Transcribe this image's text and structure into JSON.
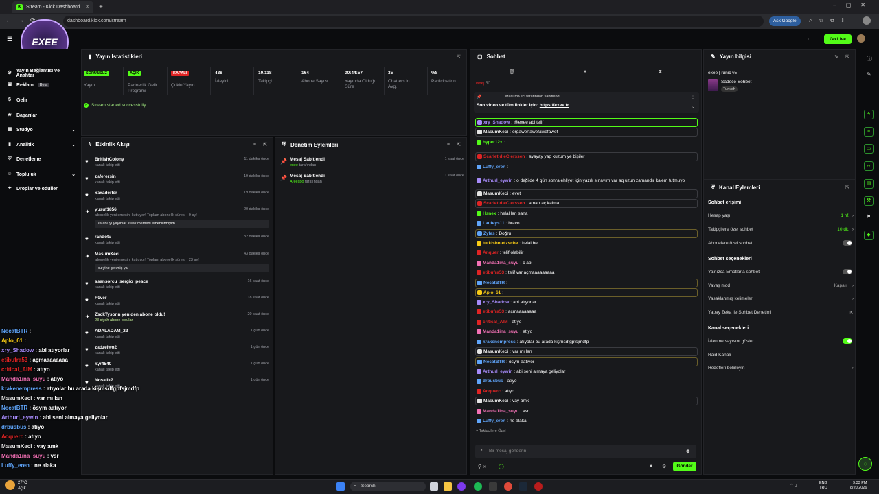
{
  "browser": {
    "tab_title": "Stream - Kick Dashboard",
    "url": "dashboard.kick.com/stream",
    "ask_google": "Ask Google"
  },
  "header": {
    "go_live": "Go Live"
  },
  "overlay_logo": {
    "text": "EXEE"
  },
  "nav": {
    "items": [
      {
        "label": "Yayın Bağlantısı ve Anahtar"
      },
      {
        "label": "Reklam",
        "badge": "Beta"
      },
      {
        "label": "Gelir"
      },
      {
        "label": "Başarılar"
      },
      {
        "label": "Stüdyo"
      },
      {
        "label": "Analitik"
      },
      {
        "label": "Denetleme"
      },
      {
        "label": "Topluluk"
      },
      {
        "label": "Droplar ve ödüller"
      }
    ]
  },
  "stats": {
    "title": "Yayın İstatistikleri",
    "items": [
      {
        "value": "SORUNSUZ",
        "label": "Yayın",
        "color": "#53fc18"
      },
      {
        "value": "AÇIK",
        "label": "Partnerlik Gelir Programı",
        "color": "#53fc18"
      },
      {
        "value": "KAPALI",
        "label": "Çoklu Yayın",
        "color": "#e02424"
      },
      {
        "value": "438",
        "label": "İzleyici"
      },
      {
        "value": "10.118",
        "label": "Takipçi"
      },
      {
        "value": "164",
        "label": "Abone Sayısı"
      },
      {
        "value": "00:44:57",
        "label": "Yayında Olduğu Süre"
      },
      {
        "value": "35",
        "label": "Chatters in Avg."
      },
      {
        "value": "%8",
        "label": "Participation"
      }
    ],
    "success_message": "Stream started successfully."
  },
  "activity": {
    "title": "Etkinlik Akışı",
    "items": [
      {
        "name": "BritishColony",
        "sub": "kanalı takip etti",
        "time": "11 dakika önce"
      },
      {
        "name": "zaferersin",
        "sub": "kanalı takip etti",
        "time": "19 dakika önce"
      },
      {
        "name": "xaxaderler",
        "sub": "kanalı takip etti",
        "time": "19 dakika önce"
      },
      {
        "name": "yusuf1856",
        "sub": "abonelik yenilemesini kutluyor! Toplam abonelik süresi · 9 ay!",
        "time": "20 dakika önce",
        "msg": "sa abi iyi yayınlar kulak memeni emebilirmiyim"
      },
      {
        "name": "randotv",
        "sub": "kanalı takip etti",
        "time": "32 dakika önce"
      },
      {
        "name": "MasumKeci",
        "sub": "abonelik yenilemesini kutluyor! Toplam abonelik süresi · 23 ay!",
        "time": "43 dakika önce",
        "msg": "bu yine çekmiş ya"
      },
      {
        "name": "asansorcu_sergio_peace",
        "sub": "kanalı takip etti",
        "time": "16 saat önce"
      },
      {
        "name": "F1ver",
        "sub": "kanalı takip etti",
        "time": "18 saat önce"
      },
      {
        "name": "ZackTysonn yeniden abone oldu!",
        "sub": "28 siyah abone oldular",
        "time": "20 saat önce"
      },
      {
        "name": "ADALADAM_22",
        "sub": "kanalı takip etti",
        "time": "1 gün önce"
      },
      {
        "name": "zadzelwo2",
        "sub": "kanalı takip etti",
        "time": "1 gün önce"
      },
      {
        "name": "kyr4540",
        "sub": "kanalı takip etti",
        "time": "1 gün önce"
      },
      {
        "name": "Nosalik7",
        "sub": "kanalı takip etti",
        "time": "1 gün önce"
      }
    ]
  },
  "moderation": {
    "title": "Denetim Eylemleri",
    "items": [
      {
        "name": "Mesaj Sabitlendi",
        "by": "exee",
        "by_suffix": "tarafından",
        "time": "1 saat önce"
      },
      {
        "name": "Mesaj Sabitlendi",
        "by": "Areespo",
        "by_suffix": "tarafından",
        "time": "11 saat önce"
      }
    ]
  },
  "chat": {
    "title": "Sohbet",
    "top_user": "nnq",
    "top_count": "50",
    "pinned_header": "MasumKeci tarafından sabitlendi",
    "pinned_text": "Son video ve tüm linkler için:",
    "pinned_link": "https://exee.tr",
    "messages": [
      {
        "user": "xry_Shadow",
        "color": "#a78bfa",
        "text": "@exee abi telif",
        "style": "gr"
      },
      {
        "user": "MasumKeci",
        "color": "#e5e5e5",
        "text": "ergawerfawefawefawef",
        "style": "bx"
      },
      {
        "user": "hyper12x",
        "color": "#53fc18",
        "text": "",
        "style": ""
      },
      {
        "user": "ScarletIdleClerssen",
        "color": "#e02424",
        "text": "ayayay yap kuzum ye bişiler",
        "style": "bx"
      },
      {
        "user": "Luffy_eren",
        "color": "#60a5fa",
        "text": "",
        "style": ""
      },
      {
        "user": "Arthurl_eywin",
        "color": "#a78bfa",
        "text": "o değilde 4 gün sonra ehliyet için yazılı sınavım var aq uzun zamandır kalem tutmuyo",
        "style": ""
      },
      {
        "user": "MasumKeci",
        "color": "#e5e5e5",
        "text": "evet",
        "style": "bx"
      },
      {
        "user": "ScarletIdleClerssen",
        "color": "#e02424",
        "text": "aman aç kalma",
        "style": "bx"
      },
      {
        "user": "Hsnex",
        "color": "#53fc18",
        "text": "helal lan sana",
        "style": ""
      },
      {
        "user": "Laufeys11",
        "color": "#60a5fa",
        "text": "bravo",
        "style": ""
      },
      {
        "user": "Zyles",
        "color": "#60a5fa",
        "text": "Doğru",
        "style": "hl"
      },
      {
        "user": "turkishnietzsche",
        "color": "#facc15",
        "text": "helal be",
        "style": ""
      },
      {
        "user": "Anquer",
        "color": "#e02424",
        "text": "telif olabilir",
        "style": ""
      },
      {
        "user": "Manda1ina_suyu",
        "color": "#f472b6",
        "text": "c abi",
        "style": ""
      },
      {
        "user": "etibufra53",
        "color": "#e02424",
        "text": "telif var açmaaaaaaaaa",
        "style": ""
      },
      {
        "user": "NecatBTR",
        "color": "#60a5fa",
        "text": "",
        "style": "hl"
      },
      {
        "user": "Aplo_61",
        "color": "#facc15",
        "text": "",
        "style": "hl"
      },
      {
        "user": "xry_Shadow",
        "color": "#a78bfa",
        "text": "abi atıyorlar",
        "style": ""
      },
      {
        "user": "etibufra53",
        "color": "#e02424",
        "text": "açmaaaaaaaa",
        "style": ""
      },
      {
        "user": "critical_AIM",
        "color": "#e02424",
        "text": "atıyo",
        "style": ""
      },
      {
        "user": "Manda1ina_suyu",
        "color": "#f472b6",
        "text": "atıyo",
        "style": ""
      },
      {
        "user": "krakenempress",
        "color": "#60a5fa",
        "text": "atıyolar bu arada kişmsdfgpfsjmdfp",
        "style": ""
      },
      {
        "user": "MasumKeci",
        "color": "#e5e5e5",
        "text": "var mı lan",
        "style": "bx"
      },
      {
        "user": "NecatBTR",
        "color": "#60a5fa",
        "text": "ösym aatıyor",
        "style": "hl"
      },
      {
        "user": "Arthurl_eywin",
        "color": "#a78bfa",
        "text": "abi seni almaya geliyolar",
        "style": ""
      },
      {
        "user": "drbusbus",
        "color": "#60a5fa",
        "text": "atıyo",
        "style": ""
      },
      {
        "user": "Acquerc",
        "color": "#e02424",
        "text": "atıyo",
        "style": ""
      },
      {
        "user": "MasumKeci",
        "color": "#e5e5e5",
        "text": "vay amk",
        "style": "bx"
      },
      {
        "user": "Manda1ina_suyu",
        "color": "#f472b6",
        "text": "vsr",
        "style": ""
      },
      {
        "user": "Luffy_eren",
        "color": "#60a5fa",
        "text": "ne alaka",
        "style": ""
      }
    ],
    "followers_only": "Takipçilere Özel",
    "placeholder": "Bir mesaj gönderin",
    "send": "Gönder"
  },
  "stream_info": {
    "title": "Yayın bilgisi",
    "stream_title": "exee | runic v5",
    "category": "Sadece Sohbet",
    "language": "Turkish"
  },
  "channel_actions": {
    "title": "Kanal Eylemleri",
    "chat_access": "Sohbet erişimi",
    "account_age": "Hesap yaşı",
    "account_age_value": "1 hf.",
    "followers_chat": "Takipçilere özel sohbet",
    "followers_chat_value": "10 dk.",
    "subs_chat": "Abonelere özel sohbet",
    "chat_options": "Sohbet seçenekleri",
    "emotes_only": "Yalnızca Emotlarla sohbet",
    "slow_mode": "Yavaş mod",
    "slow_mode_value": "Kapalı",
    "banned_words": "Yasaklanmış kelimeler",
    "ai_moderation": "Yapay Zeka ile Sohbet Denetimi",
    "channel_options": "Kanal seçenekleri",
    "show_viewers": "İzlenme sayısını göster",
    "raid_channel": "Raid Kanalı",
    "set_goals": "Hedefleri belirleyin"
  },
  "overlay_chat": [
    {
      "user": "NecatBTR",
      "color": "#60a5fa",
      "text": ""
    },
    {
      "user": "Aplo_61",
      "color": "#facc15",
      "text": ""
    },
    {
      "user": "xry_Shadow",
      "color": "#a78bfa",
      "text": "abi atıyorlar"
    },
    {
      "user": "etibufra53",
      "color": "#e02424",
      "text": "açmaaaaaaaa"
    },
    {
      "user": "critical_AIM",
      "color": "#e02424",
      "text": "atıyo"
    },
    {
      "user": "Manda1ina_suyu",
      "color": "#f472b6",
      "text": "atıyo"
    },
    {
      "user": "krakenempress",
      "color": "#60a5fa",
      "text": "atıyolar bu arada kişmsdfgpfsjmdfp"
    },
    {
      "user": "MasumKeci",
      "color": "#e5e5e5",
      "text": "var mı lan"
    },
    {
      "user": "NecatBTR",
      "color": "#60a5fa",
      "text": "ösym aatıyor"
    },
    {
      "user": "Arthurl_eywin",
      "color": "#a78bfa",
      "text": "abi seni almaya geliyolar"
    },
    {
      "user": "drbusbus",
      "color": "#60a5fa",
      "text": "atıyo"
    },
    {
      "user": "Acquerc",
      "color": "#e02424",
      "text": "atıyo"
    },
    {
      "user": "MasumKeci",
      "color": "#e5e5e5",
      "text": "vay amk"
    },
    {
      "user": "Manda1ina_suyu",
      "color": "#f472b6",
      "text": "vsr"
    },
    {
      "user": "Luffy_eren",
      "color": "#60a5fa",
      "text": "ne alaka"
    }
  ],
  "taskbar": {
    "weather_temp": "27°C",
    "weather_desc": "Açık",
    "search": "Search",
    "lang": "ENG",
    "lang2": "TRQ",
    "time": "9:33 PM",
    "date": "8/20/2026"
  }
}
